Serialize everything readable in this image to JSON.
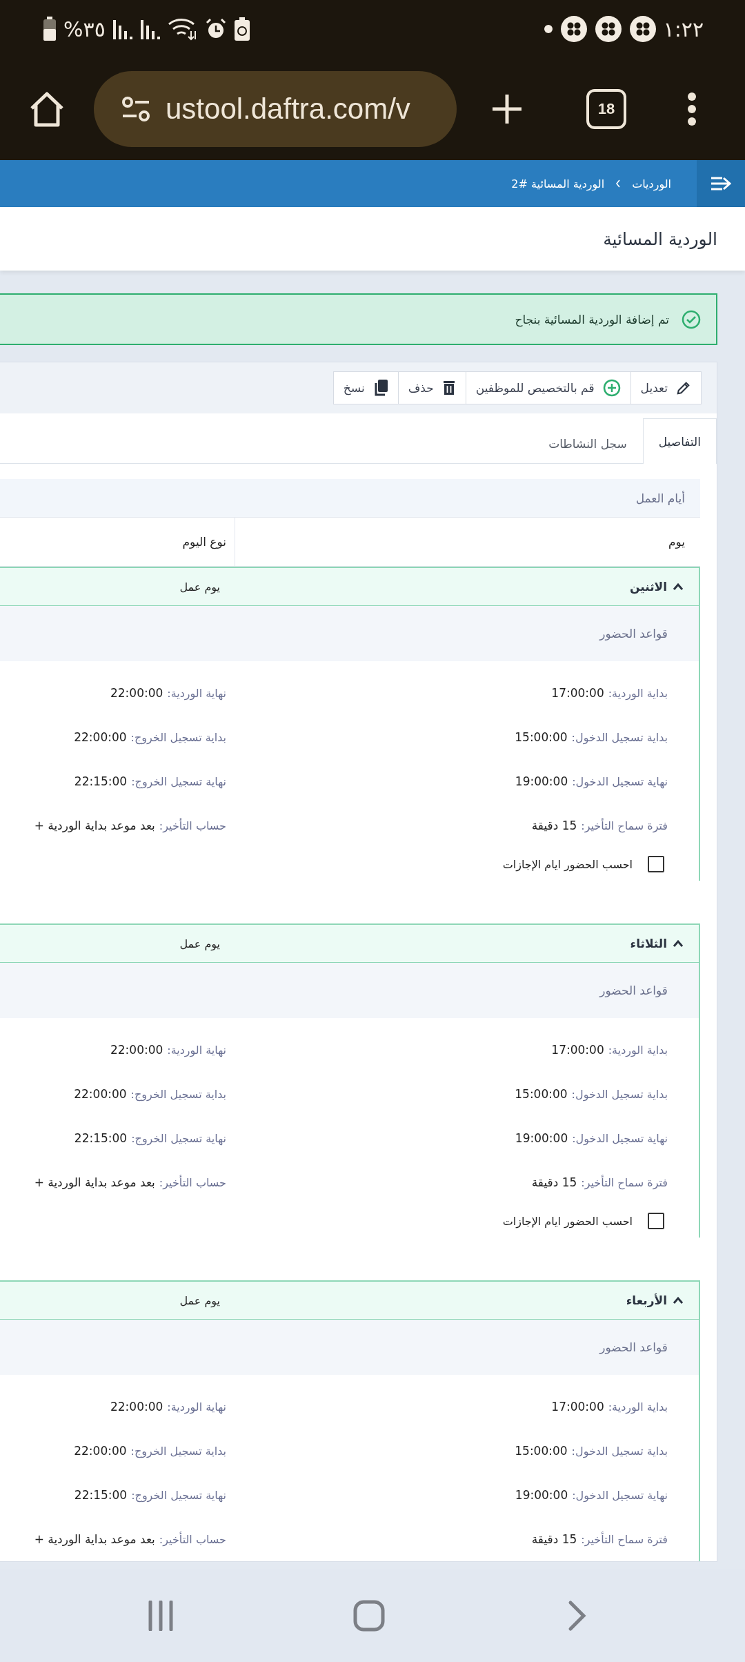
{
  "status_bar": {
    "time": "١:٢٢",
    "battery": "%٣٥"
  },
  "browser": {
    "url": "ustool.daftra.com/v",
    "tab_count": "18"
  },
  "breadcrumb": [
    "الورديات",
    "الوردية المسائية #2"
  ],
  "page_title": "الوردية المسائية",
  "alert": {
    "text": "تم إضافة الوردية المسائية بنجاح"
  },
  "actions": [
    {
      "kind": "edit",
      "label": "تعديل"
    },
    {
      "kind": "assign",
      "label": "قم بالتخصيص للموظفين"
    },
    {
      "kind": "delete",
      "label": "حذف"
    },
    {
      "kind": "copy",
      "label": "نسخ"
    }
  ],
  "tabs": [
    {
      "label": "التفاصيل",
      "selected": true
    },
    {
      "label": "سجل النشاطات",
      "selected": false
    }
  ],
  "section_title": "أيام العمل",
  "columns": [
    "يوم",
    "نوع اليوم"
  ],
  "days": [
    {
      "name": "الاثنين",
      "expanded": true,
      "type": "يوم عمل",
      "rules_title": "قواعد الحضور",
      "fields": [
        {
          "label": "بداية الوردية:",
          "value": "17:00:00"
        },
        {
          "label": "نهاية الوردية:",
          "value": "22:00:00"
        },
        {
          "label": "بداية تسجيل الدخول:",
          "value": "15:00:00"
        },
        {
          "label": "بداية تسجيل الخروج:",
          "value": "22:00:00"
        },
        {
          "label": "نهاية تسجيل الدخول:",
          "value": "19:00:00"
        },
        {
          "label": "نهاية تسجيل الخروج:",
          "value": "22:15:00"
        },
        {
          "label": "فترة سماح التأخير:",
          "value": "15 دقيقة"
        },
        {
          "label": "حساب التأخير:",
          "value": "بعد موعد بداية الوردية +"
        }
      ],
      "option": {
        "label": "احسب الحضور ايام الإجازات",
        "checked": false
      }
    },
    {
      "name": "الثلاثاء",
      "expanded": true,
      "type": "يوم عمل",
      "rules_title": "قواعد الحضور",
      "fields": [
        {
          "label": "بداية الوردية:",
          "value": "17:00:00"
        },
        {
          "label": "نهاية الوردية:",
          "value": "22:00:00"
        },
        {
          "label": "بداية تسجيل الدخول:",
          "value": "15:00:00"
        },
        {
          "label": "بداية تسجيل الخروج:",
          "value": "22:00:00"
        },
        {
          "label": "نهاية تسجيل الدخول:",
          "value": "19:00:00"
        },
        {
          "label": "نهاية تسجيل الخروج:",
          "value": "22:15:00"
        },
        {
          "label": "فترة سماح التأخير:",
          "value": "15 دقيقة"
        },
        {
          "label": "حساب التأخير:",
          "value": "بعد موعد بداية الوردية +"
        }
      ],
      "option": {
        "label": "احسب الحضور ايام الإجازات",
        "checked": false
      }
    },
    {
      "name": "الأربعاء",
      "expanded": true,
      "type": "يوم عمل",
      "rules_title": "قواعد الحضور",
      "fields": [
        {
          "label": "بداية الوردية:",
          "value": "17:00:00"
        },
        {
          "label": "نهاية الوردية:",
          "value": "22:00:00"
        },
        {
          "label": "بداية تسجيل الدخول:",
          "value": "15:00:00"
        },
        {
          "label": "بداية تسجيل الخروج:",
          "value": "22:00:00"
        },
        {
          "label": "نهاية تسجيل الدخول:",
          "value": "19:00:00"
        },
        {
          "label": "نهاية تسجيل الخروج:",
          "value": "22:15:00"
        },
        {
          "label": "فترة سماح التأخير:",
          "value": "15 دقيقة"
        },
        {
          "label": "حساب التأخير:",
          "value": "بعد موعد بداية الوردية +"
        }
      ]
    }
  ]
}
